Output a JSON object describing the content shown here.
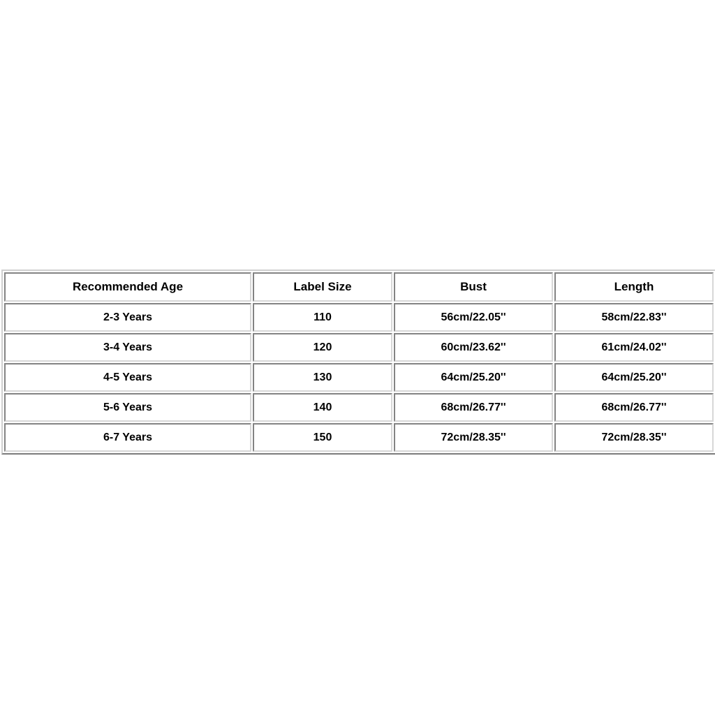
{
  "chart_data": {
    "type": "table",
    "title": "",
    "columns": [
      "Recommended Age",
      "Label Size",
      "Bust",
      "Length"
    ],
    "rows": [
      [
        "2-3 Years",
        "110",
        "56cm/22.05''",
        "58cm/22.83''"
      ],
      [
        "3-4 Years",
        "120",
        "60cm/23.62''",
        "61cm/24.02''"
      ],
      [
        "4-5 Years",
        "130",
        "64cm/25.20''",
        "64cm/25.20''"
      ],
      [
        "5-6 Years",
        "140",
        "68cm/26.77''",
        "68cm/26.77''"
      ],
      [
        "6-7 Years",
        "150",
        "72cm/28.35''",
        "72cm/28.35''"
      ]
    ]
  },
  "size_chart": {
    "headers": {
      "age": "Recommended Age",
      "label_size": "Label Size",
      "bust": "Bust",
      "length": "Length"
    },
    "rows": [
      {
        "age": "2-3 Years",
        "label_size": "110",
        "bust": "56cm/22.05''",
        "length": "58cm/22.83''"
      },
      {
        "age": "3-4 Years",
        "label_size": "120",
        "bust": "60cm/23.62''",
        "length": "61cm/24.02''"
      },
      {
        "age": "4-5 Years",
        "label_size": "130",
        "bust": "64cm/25.20''",
        "length": "64cm/25.20''"
      },
      {
        "age": "5-6 Years",
        "label_size": "140",
        "bust": "68cm/26.77''",
        "length": "68cm/26.77''"
      },
      {
        "age": "6-7 Years",
        "label_size": "150",
        "bust": "72cm/28.35''",
        "length": "72cm/28.35''"
      }
    ]
  },
  "colors": {
    "page_background": "#ffffff",
    "cell_background": "#ffffff",
    "text": "#000000",
    "border": "#d7d7d7"
  }
}
